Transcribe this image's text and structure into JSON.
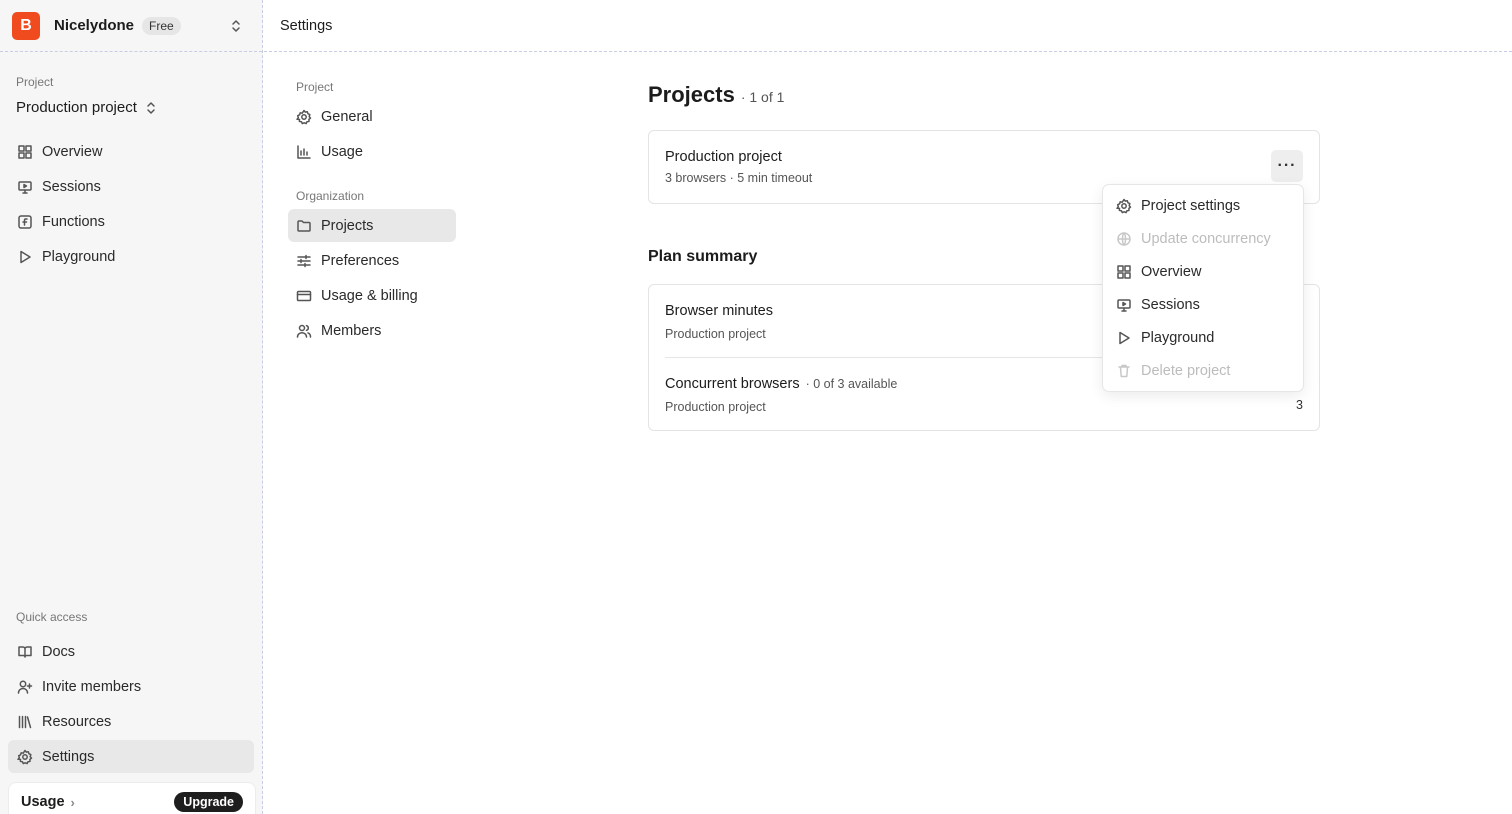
{
  "org": {
    "logo_letter": "B",
    "name": "Nicelydone",
    "plan": "Free"
  },
  "sidebar": {
    "project_label": "Project",
    "project_name": "Production project",
    "nav": [
      {
        "label": "Overview",
        "icon": "grid-icon"
      },
      {
        "label": "Sessions",
        "icon": "monitor-icon"
      },
      {
        "label": "Functions",
        "icon": "function-icon"
      },
      {
        "label": "Playground",
        "icon": "play-icon"
      }
    ],
    "quick_access_label": "Quick access",
    "quick": [
      {
        "label": "Docs",
        "icon": "book-icon"
      },
      {
        "label": "Invite members",
        "icon": "user-plus-icon"
      },
      {
        "label": "Resources",
        "icon": "library-icon"
      },
      {
        "label": "Settings",
        "icon": "gear-icon",
        "active": true
      }
    ],
    "usage_label": "Usage",
    "upgrade_label": "Upgrade"
  },
  "topbar": {
    "title": "Settings"
  },
  "settings_nav": {
    "project_label": "Project",
    "project_items": [
      {
        "label": "General",
        "icon": "gear-icon"
      },
      {
        "label": "Usage",
        "icon": "bar-chart-icon"
      }
    ],
    "org_label": "Organization",
    "org_items": [
      {
        "label": "Projects",
        "icon": "folder-icon",
        "active": true
      },
      {
        "label": "Preferences",
        "icon": "sliders-icon"
      },
      {
        "label": "Usage & billing",
        "icon": "credit-card-icon"
      },
      {
        "label": "Members",
        "icon": "users-icon"
      }
    ]
  },
  "main": {
    "title": "Projects",
    "count": "· 1 of 1",
    "project_card": {
      "name": "Production project",
      "details": "3 browsers · 5 min timeout",
      "more_label": "···"
    },
    "plan_summary_title": "Plan summary",
    "plan_rows": [
      {
        "title": "Browser minutes",
        "meta": "",
        "project": "Production project",
        "value": ""
      },
      {
        "title": "Concurrent browsers",
        "meta": "· 0 of 3 available",
        "project": "Production project",
        "value": "3"
      }
    ]
  },
  "menu": {
    "items": [
      {
        "label": "Project settings",
        "icon": "gear-icon",
        "disabled": false
      },
      {
        "label": "Update concurrency",
        "icon": "globe-icon",
        "disabled": true
      },
      {
        "label": "Overview",
        "icon": "grid-icon",
        "disabled": false
      },
      {
        "label": "Sessions",
        "icon": "monitor-icon",
        "disabled": false
      },
      {
        "label": "Playground",
        "icon": "play-icon",
        "disabled": false
      },
      {
        "label": "Delete project",
        "icon": "trash-icon",
        "disabled": true
      }
    ]
  },
  "colors": {
    "brand": "#f04a1f",
    "sidebar_bg": "#f6f6f6",
    "active_bg": "#e8e8e8",
    "divider": "#c9cde4"
  }
}
